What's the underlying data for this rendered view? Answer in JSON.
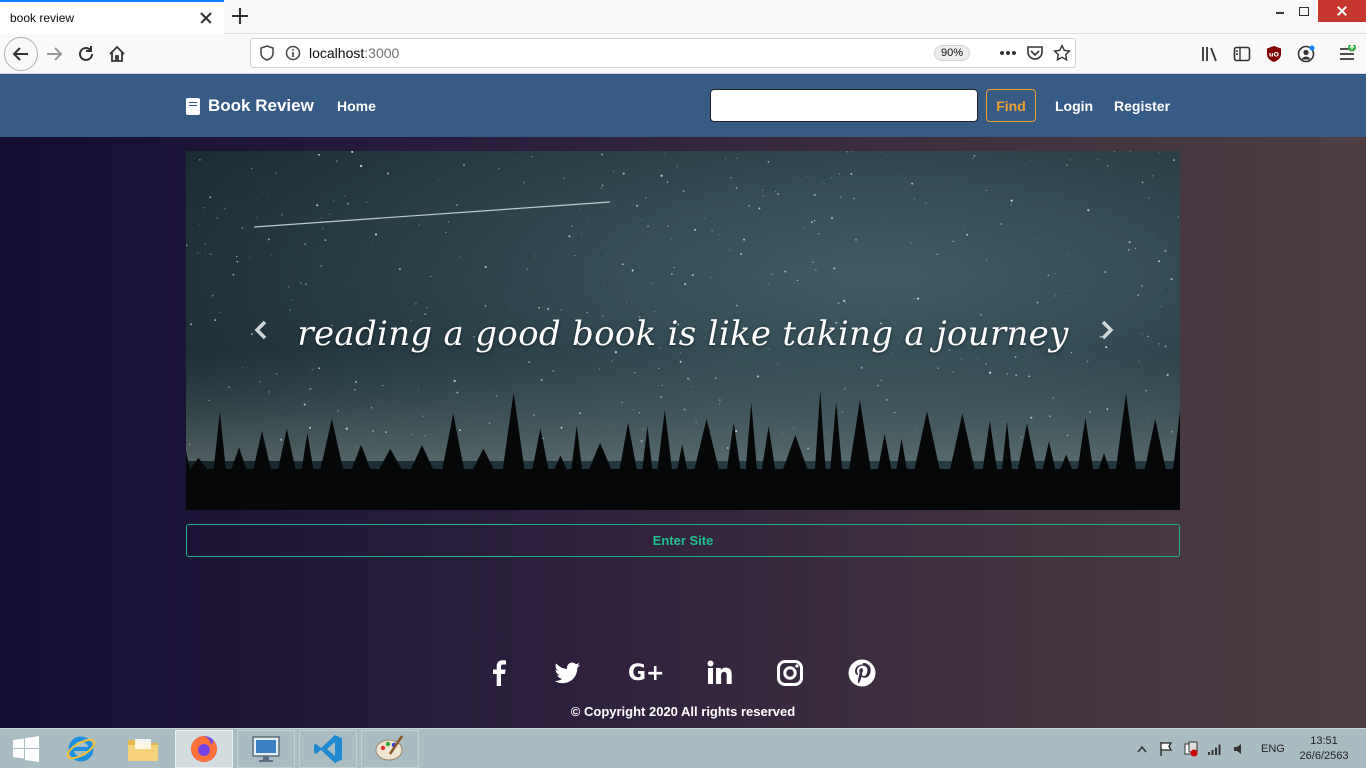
{
  "browser": {
    "tab_title": "book review",
    "url_host": "localhost",
    "url_port": ":3000",
    "zoom": "90%"
  },
  "site": {
    "brand": "Book Review",
    "nav": {
      "home": "Home",
      "login": "Login",
      "register": "Register"
    },
    "search": {
      "value": "",
      "button": "Find"
    },
    "hero": {
      "caption": "reading a good book is like taking a journey"
    },
    "enter_button": "Enter Site",
    "social": [
      "facebook",
      "twitter",
      "google-plus",
      "linkedin",
      "instagram",
      "pinterest"
    ],
    "copyright": "© Copyright 2020 All rights reserved"
  },
  "taskbar": {
    "apps": [
      "start",
      "internet-explorer",
      "file-explorer",
      "firefox",
      "remote-desktop",
      "vscode",
      "paint"
    ],
    "language": "ENG",
    "time": "13:51",
    "date": "26/6/2563"
  },
  "colors": {
    "navbar": "#365b85",
    "find_accent": "#f0a030",
    "enter_accent": "#20c08f"
  }
}
